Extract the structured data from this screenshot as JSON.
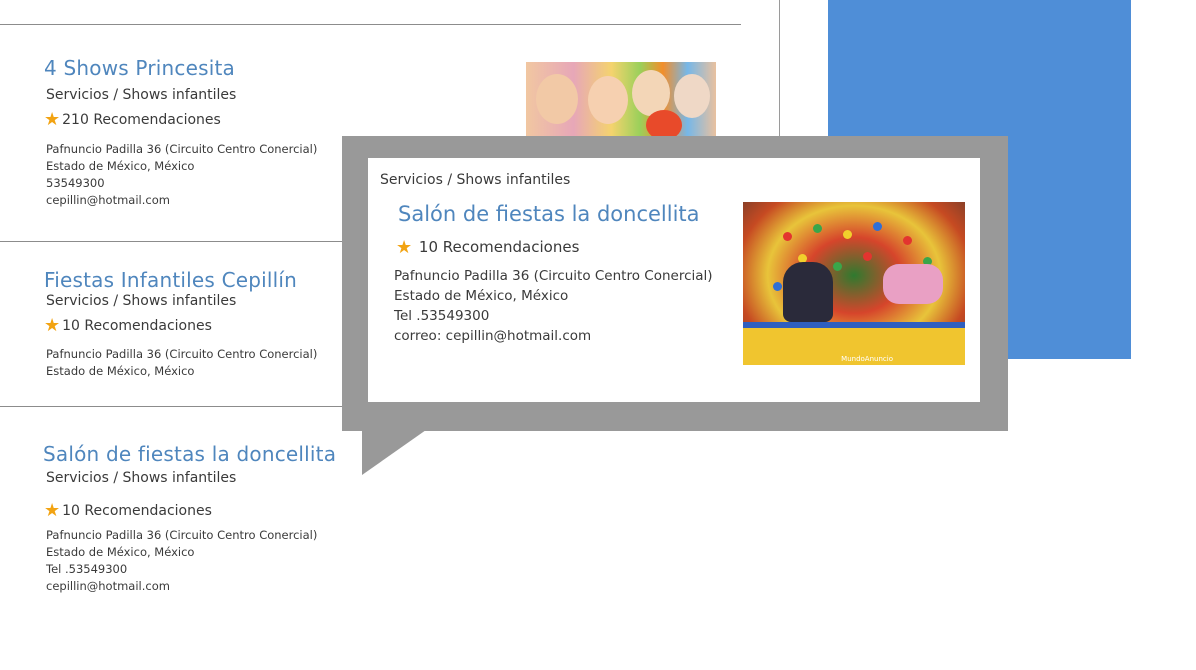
{
  "listings": [
    {
      "title": "4 Shows Princesita",
      "category": "Servicios / Shows infantiles",
      "recommendations": "210 Recomendaciones",
      "address": "Pafnuncio Padilla 36 (Circuito Centro Conercial)",
      "region": "Estado de México, México",
      "phone": "53549300",
      "email": "cepillin@hotmail.com"
    },
    {
      "title": "Fiestas Infantiles Cepillín",
      "category": "Servicios / Shows infantiles",
      "recommendations": "10 Recomendaciones",
      "address": "Pafnuncio Padilla 36 (Circuito Centro Conercial)",
      "region": "Estado de México, México"
    },
    {
      "title": "Salón de fiestas la doncellita",
      "category": "Servicios / Shows infantiles",
      "recommendations": "10 Recomendaciones",
      "address": "Pafnuncio Padilla 36 (Circuito Centro Conercial)",
      "region": "Estado de México, México",
      "phone": "Tel .53549300",
      "email": "cepillin@hotmail.com"
    }
  ],
  "popover": {
    "category": "Servicios / Shows infantiles",
    "title": "Salón de fiestas la doncellita",
    "recommendations": "10 Recomendaciones",
    "address": "Pafnuncio Padilla 36 (Circuito Centro Conercial)",
    "region": "Estado de México, México",
    "phone": "Tel .53549300",
    "email": "correo: cepillin@hotmail.com",
    "image_caption": "MundoAnuncio"
  },
  "colors": {
    "title": "#4f86bd",
    "star": "#f2a312",
    "panel": "#4f8ed7",
    "popover_frame": "#999999"
  },
  "icons": {
    "rating": "star-icon"
  }
}
